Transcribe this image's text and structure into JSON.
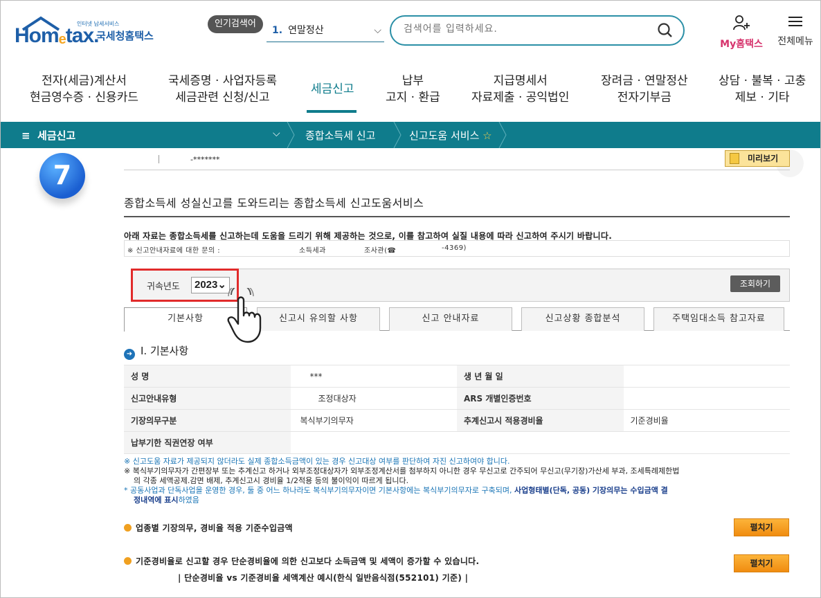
{
  "header": {
    "logo_small": "인터넷 납세서비스",
    "logo_home": "Hom",
    "logo_e": "e",
    "logo_tax": "tax.",
    "logo_kr": "국세청홈택스",
    "popular_badge": "인기검색어",
    "popular_rank": "1.",
    "popular_term": "연말정산",
    "search_placeholder": "검색어를 입력하세요.",
    "my_hometax": "My홈택스",
    "all_menu": "전체메뉴"
  },
  "gnb": [
    {
      "line1": "전자(세금)계산서",
      "line2": "현금영수증 · 신용카드"
    },
    {
      "line1": "국세증명 · 사업자등록",
      "line2": "세금관련 신청/신고"
    },
    {
      "line1": "세금신고",
      "line2": ""
    },
    {
      "line1": "납부",
      "line2": "고지 · 환급"
    },
    {
      "line1": "지급명세서",
      "line2": "자료제출 · 공익법인"
    },
    {
      "line1": "장려금 · 연말정산",
      "line2": "전자기부금"
    },
    {
      "line1": "상담 · 불복 · 고충",
      "line2": "제보 · 기타"
    }
  ],
  "subbar": {
    "menu_label": "세금신고",
    "crumb1": "종합소득세 신고",
    "crumb2": "신고도움 서비스"
  },
  "step_number": "7",
  "top_mask": "-*******",
  "preview_button": "미리보기",
  "page_title": "종합소득세 성실신고를 도와드리는 종합소득세 신고도움서비스",
  "notice": "아래 자료는 종합소득세를 신고하는데 도움을 드리기 위해 제공하는 것으로, 이를 참고하여 실질 내용에 따라 신고하여 주시기 바랍니다.",
  "inquiry": {
    "label": "※ 신고안내자료에 대한 문의 :",
    "dept": "소득세과",
    "officer": "조사관(☎",
    "phone": "-4369)"
  },
  "year": {
    "label": "귀속년도",
    "value": "2023",
    "query_button": "조회하기"
  },
  "tabs": [
    "기본사항",
    "신고시 유의할 사항",
    "신고 안내자료",
    "신고상황 종합분석",
    "주택임대소득 참고자료"
  ],
  "section_title": "Ⅰ. 기본사항",
  "info_table": [
    {
      "k1": "성          명",
      "v1": "***",
      "k2": "생  년  월  일",
      "v2": ""
    },
    {
      "k1": "신고안내유형",
      "v1": "조정대상자",
      "k2": "ARS 개별인증번호",
      "v2": ""
    },
    {
      "k1": "기장의무구분",
      "v1": "복식부기의무자",
      "k2": "추계신고시 적용경비율",
      "v2": "기준경비율"
    },
    {
      "k1": "납부기한 직권연장 여부",
      "v1": "",
      "k2": "",
      "v2": ""
    }
  ],
  "notes": {
    "n1": "※  신고도움 자료가 제공되지 않더라도 실제 종합소득금액이 있는 경우 신고대상 여부를 판단하여 자진 신고하여야 합니다.",
    "n2a": "※  복식부기의무자가 간편장부 또는 추계신고 하거나 외부조정대상자가 외부조정계산서를 첨부하지 아니한 경우 무신고로 간주되어 무신고(무기장)가산세 부과, 조세특례제한법",
    "n2b": "의 각종 세액공제.감면 배제, 추계신고시 경비율 1/2적용 등의 불이익이 따르게 됩니다.",
    "n3a": "*   공동사업과 단독사업을 운영한 경우, 둘 중 어느 하나라도 복식부기의무자이면 기본사항에는 복식부기의무자로 구축되며,",
    "n3b": "사업형태별(단독, 공동) 기장의무는 수입금액 결",
    "n3c": "정내역에 표시",
    "n3d": "하였음"
  },
  "accordion1": "업종별 기장의무, 경비율 적용 기준수입금액",
  "accordion2": "기준경비율로 신고할 경우 단순경비율에 의한 신고보다 소득금액 및 세액이 증가할 수 있습니다.",
  "expand_label": "펼치기",
  "example_line": "| 단순경비율 vs 기준경비율 세액계산 예시(한식 일반음식점(552101) 기준) |",
  "colors": {
    "teal": "#0f7c8c",
    "accent": "#f08c10",
    "red": "#e12b2b"
  }
}
